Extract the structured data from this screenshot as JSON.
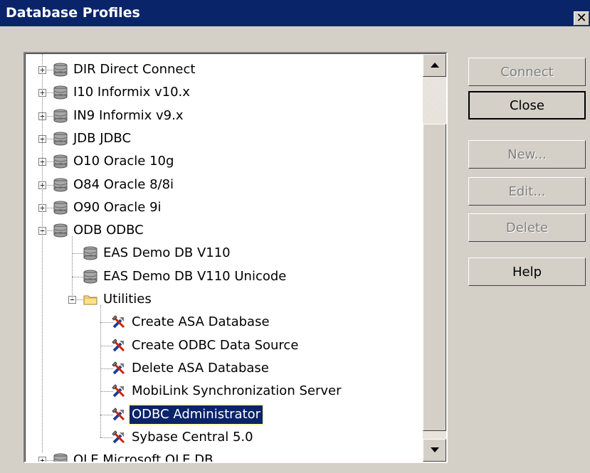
{
  "window": {
    "title": "Database Profiles",
    "close_glyph": "✕"
  },
  "tree": {
    "items": [
      {
        "label": "DIR Direct Connect",
        "kind": "db",
        "expander": "+",
        "level": 0
      },
      {
        "label": "I10 Informix v10.x",
        "kind": "db",
        "expander": "+",
        "level": 0
      },
      {
        "label": "IN9 Informix v9.x",
        "kind": "db",
        "expander": "+",
        "level": 0
      },
      {
        "label": "JDB JDBC",
        "kind": "db",
        "expander": "+",
        "level": 0
      },
      {
        "label": "O10 Oracle 10g",
        "kind": "db",
        "expander": "+",
        "level": 0
      },
      {
        "label": "O84 Oracle 8/8i",
        "kind": "db",
        "expander": "+",
        "level": 0
      },
      {
        "label": "O90 Oracle 9i",
        "kind": "db",
        "expander": "+",
        "level": 0
      },
      {
        "label": "ODB ODBC",
        "kind": "db",
        "expander": "−",
        "level": 0
      },
      {
        "label": "EAS Demo DB V110",
        "kind": "db",
        "expander": "",
        "level": 1
      },
      {
        "label": "EAS Demo DB V110 Unicode",
        "kind": "db",
        "expander": "",
        "level": 1
      },
      {
        "label": "Utilities",
        "kind": "folder",
        "expander": "−",
        "level": 1
      },
      {
        "label": "Create ASA Database",
        "kind": "tool",
        "expander": "",
        "level": 2
      },
      {
        "label": "Create ODBC Data Source",
        "kind": "tool",
        "expander": "",
        "level": 2
      },
      {
        "label": "Delete ASA Database",
        "kind": "tool",
        "expander": "",
        "level": 2
      },
      {
        "label": "MobiLink Synchronization Server",
        "kind": "tool",
        "expander": "",
        "level": 2
      },
      {
        "label": "ODBC Administrator",
        "kind": "tool",
        "expander": "",
        "level": 2,
        "selected": true
      },
      {
        "label": "Sybase Central 5.0",
        "kind": "tool",
        "expander": "",
        "level": 2
      },
      {
        "label": "OLE Microsoft OLE DB",
        "kind": "db",
        "expander": "+",
        "level": 0
      }
    ]
  },
  "buttons": {
    "connect": "Connect",
    "close": "Close",
    "new": "New...",
    "edit": "Edit...",
    "delete": "Delete",
    "help": "Help"
  },
  "colors": {
    "selection": "#0a246a",
    "titlebar": "#0a246a",
    "face": "#d4d0c8"
  }
}
